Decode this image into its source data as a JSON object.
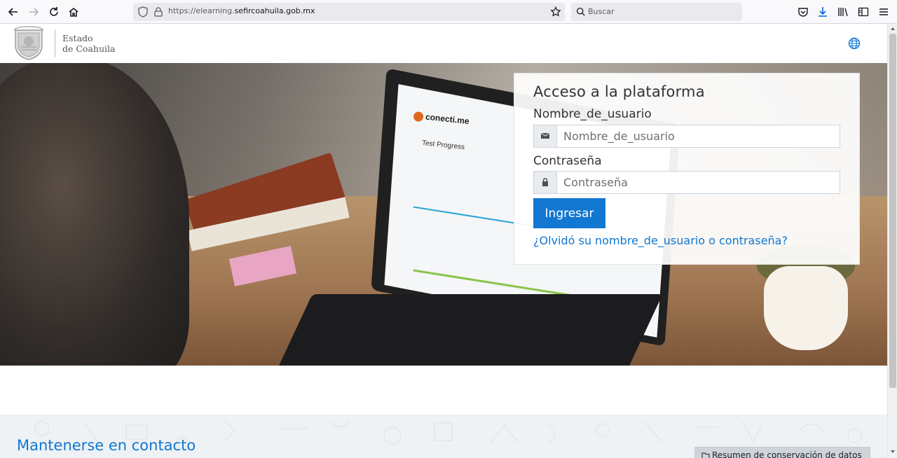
{
  "browser": {
    "url_prefix": "https://elearning.",
    "url_domain": "sefircoahuila.gob.mx",
    "search_placeholder": "Buscar"
  },
  "site": {
    "brand_line1": "Estado",
    "brand_line2": "de Coahuila"
  },
  "hero": {
    "screen_logo": "conecti.me",
    "screen_title": "Test Progress"
  },
  "login": {
    "title": "Acceso a la plataforma",
    "username_label": "Nombre_de_usuario",
    "username_placeholder": "Nombre_de_usuario",
    "password_label": "Contraseña",
    "password_placeholder": "Contraseña",
    "submit_label": "Ingresar",
    "forgot_link": "¿Olvidó su nombre_de_usuario o contraseña?"
  },
  "footer": {
    "title": "Mantenerse en contacto",
    "data_retention_button": "Resumen de conservación de datos"
  },
  "colors": {
    "accent": "#1177d1",
    "chrome_bg": "#f9f9fb"
  }
}
